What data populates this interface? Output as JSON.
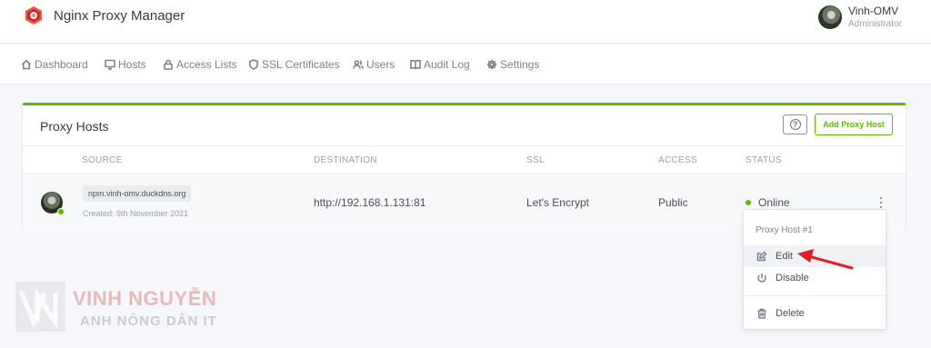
{
  "app": {
    "title": "Nginx Proxy Manager"
  },
  "user": {
    "name": "Vinh-OMV",
    "role": "Administrator"
  },
  "nav": {
    "items": [
      {
        "label": "Dashboard",
        "icon": "home-icon"
      },
      {
        "label": "Hosts",
        "icon": "monitor-icon"
      },
      {
        "label": "Access Lists",
        "icon": "lock-icon"
      },
      {
        "label": "SSL Certificates",
        "icon": "shield-icon"
      },
      {
        "label": "Users",
        "icon": "users-icon"
      },
      {
        "label": "Audit Log",
        "icon": "book-icon"
      },
      {
        "label": "Settings",
        "icon": "gear-icon"
      }
    ]
  },
  "card": {
    "title": "Proxy Hosts",
    "help_icon": "?",
    "add_button": "Add Proxy Host",
    "accent": "#5eba00",
    "columns": [
      "SOURCE",
      "DESTINATION",
      "SSL",
      "ACCESS",
      "STATUS"
    ],
    "rows": [
      {
        "source": "npm.vinh-omv.duckdns.org",
        "created": "Created: 9th November 2021",
        "destination": "http://192.168.1.131:81",
        "ssl": "Let's Encrypt",
        "access": "Public",
        "status": "Online"
      }
    ]
  },
  "dropdown": {
    "header": "Proxy Host #1",
    "items": [
      {
        "label": "Edit",
        "icon": "edit-icon"
      },
      {
        "label": "Disable",
        "icon": "power-icon"
      },
      {
        "label": "Delete",
        "icon": "trash-icon"
      }
    ]
  },
  "watermark": {
    "name": "VINH NGUYỄN",
    "sub": "ANH NÔNG DÂN IT"
  }
}
